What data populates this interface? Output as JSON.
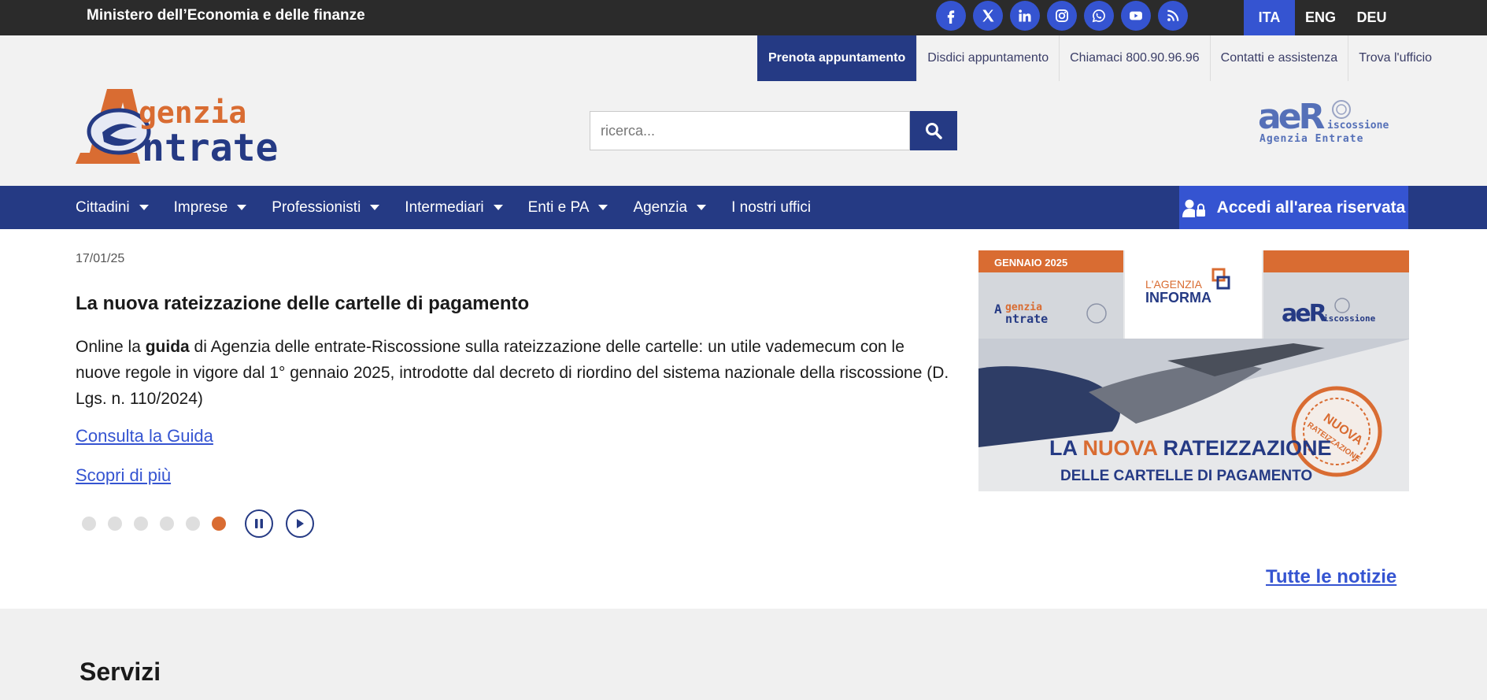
{
  "topbar": {
    "ministry": "Ministero dell’Economia e delle finanze",
    "social": [
      "facebook-icon",
      "x-icon",
      "linkedin-icon",
      "instagram-icon",
      "whatsapp-icon",
      "youtube-icon",
      "rss-icon"
    ],
    "languages": [
      {
        "label": "ITA",
        "active": true
      },
      {
        "label": "ENG",
        "active": false
      },
      {
        "label": "DEU",
        "active": false
      }
    ]
  },
  "utility": {
    "book": "Prenota appuntamento",
    "cancel": "Disdici appuntamento",
    "call": "Chiamaci 800.90.96.96",
    "contacts": "Contatti e assistenza",
    "office": "Trova l'ufficio"
  },
  "logo": {
    "line1": "genzia",
    "line2": "ntrate"
  },
  "search": {
    "placeholder": "ricerca..."
  },
  "riscossione": {
    "brand": "Riscossione",
    "sub": "Agenzia Entrate",
    "suffix": "iscossione"
  },
  "nav": {
    "items": [
      "Cittadini",
      "Imprese",
      "Professionisti",
      "Intermediari",
      "Enti e PA",
      "Agenzia",
      "I nostri uffici"
    ],
    "login": "Accedi all'area riservata"
  },
  "news": {
    "date": "17/01/25",
    "title": "La nuova rateizzazione delle cartelle di pagamento",
    "body_pre": "Online la ",
    "body_bold": "guida",
    "body_post": " di Agenzia delle entrate-Riscossione sulla rateizzazione delle cartelle: un utile vademecum con le nuove regole in vigore dal 1° gennaio 2025, introdotte dal decreto di riordino del sistema nazionale della riscossione (D. Lgs. n. 110/2024)",
    "link_guide": "Consulta la Guida",
    "link_more": "Scopri di più",
    "dots_total": 6,
    "active_dot": 6,
    "all_news": "Tutte le notizie",
    "image": {
      "month": "GENNAIO 2025",
      "informa_1": "L'AGENZIA",
      "informa_2": "INFORMA",
      "headline_1": "LA ",
      "headline_accent": "NUOVA",
      "headline_2": " RATEIZZAZIONE",
      "subline": "DELLE CARTELLE DI PAGAMENTO",
      "stamp_1": "NUOVA",
      "stamp_2": "RATEIZZAZIONE"
    }
  },
  "services": {
    "title": "Servizi"
  },
  "colors": {
    "navy": "#253a84",
    "blue": "#3554d1",
    "orange": "#d96c32",
    "dark": "#2b2b2b",
    "light": "#f2f2f2"
  }
}
